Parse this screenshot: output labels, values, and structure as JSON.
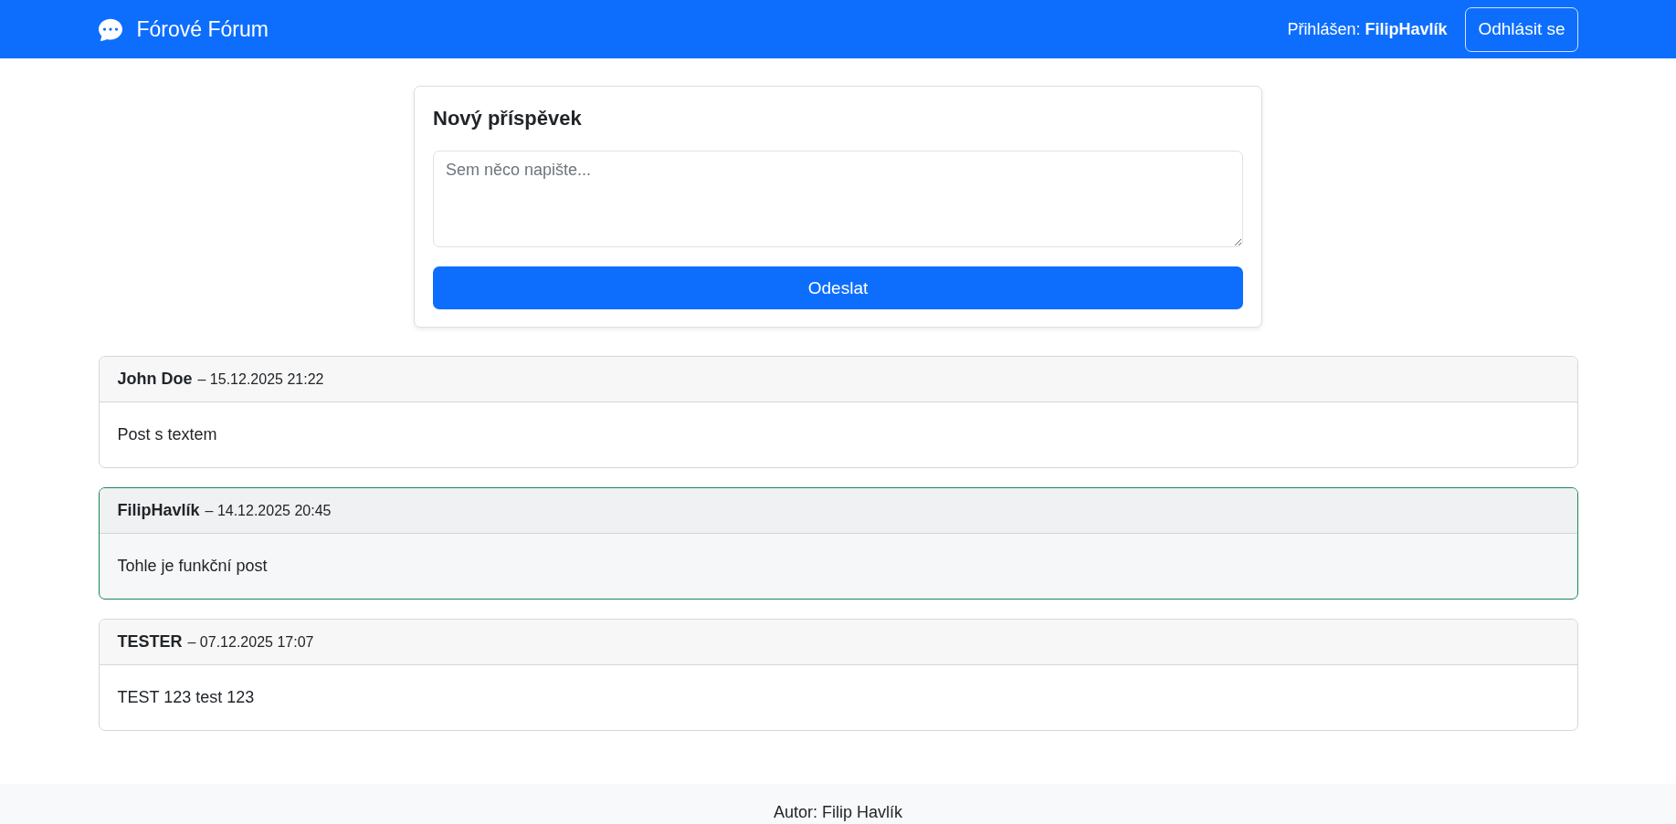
{
  "navbar": {
    "brand": "Fórové Fórum",
    "login_text": "Přihlášen: **FilipHavlík**",
    "logout_button": "Odhlásit se"
  },
  "new_post": {
    "title": "Nový příspěvek",
    "placeholder": "Sem něco napište...",
    "submit_button": "Odeslat"
  },
  "posts": [
    {
      "author": "John Doe",
      "meta": "– 15.12.2025 21:22",
      "text": "Post s textem",
      "highlighted": false
    },
    {
      "author": "FilipHavlík",
      "meta": "– 14.12.2025 20:45",
      "text": "Tohle je funkční post",
      "highlighted": true
    },
    {
      "author": "TESTER",
      "meta": "– 07.12.2025 17:07",
      "text": "TEST 123 test 123",
      "highlighted": false
    }
  ],
  "footer": {
    "text": "Autor: Filip Havlík"
  }
}
